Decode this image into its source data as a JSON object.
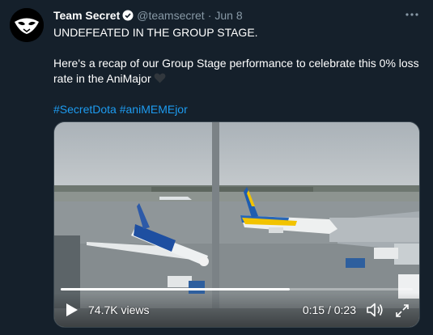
{
  "tweet": {
    "author_name": "Team Secret",
    "handle": "@teamsecret",
    "separator": "·",
    "date": "Jun 8",
    "line1": "UNDEFEATED IN THE GROUP STAGE.",
    "line2": "Here's a recap of our Group Stage performance to celebrate this 0% loss rate in the AniMajor",
    "hashtag1": "#SecretDota",
    "hashtag2": "#aniMEMEjor"
  },
  "video": {
    "views": "74.7K views",
    "time": "0:15 / 0:23",
    "progress": 0.65
  },
  "icons": {
    "verified": "verified-badge-icon",
    "more": "more-icon",
    "heart": "black-heart-icon",
    "play": "play-icon",
    "volume": "volume-icon",
    "fullscreen": "fullscreen-icon"
  },
  "colors": {
    "background": "#15202b",
    "link": "#1d9bf0",
    "muted": "#8899a6"
  }
}
